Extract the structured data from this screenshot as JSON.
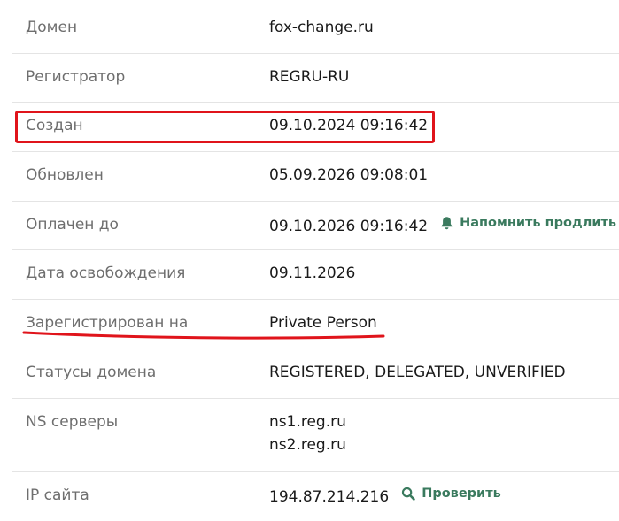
{
  "rows": [
    {
      "label": "Домен",
      "value": "fox-change.ru"
    },
    {
      "label": "Регистратор",
      "value": "REGRU-RU"
    },
    {
      "label": "Создан",
      "value": "09.10.2024 09:16:42"
    },
    {
      "label": "Обновлен",
      "value": "05.09.2026 09:08:01"
    },
    {
      "label": "Оплачен до",
      "value": "09.10.2026 09:16:42",
      "action": "Напомнить продлить"
    },
    {
      "label": "Дата освобождения",
      "value": "09.11.2026"
    },
    {
      "label": "Зарегистрирован на",
      "value": "Private Person"
    },
    {
      "label": "Статусы домена",
      "value": "REGISTERED, DELEGATED, UNVERIFIED"
    },
    {
      "label": "NS серверы",
      "values": [
        "ns1.reg.ru",
        "ns2.reg.ru"
      ]
    },
    {
      "label": "IP сайта",
      "value": "194.87.214.216",
      "action": "Проверить"
    }
  ],
  "colors": {
    "accent": "#3a7a5e",
    "highlight": "#e0141b",
    "label": "#6e6e6e",
    "text": "#1a1a1a"
  },
  "icons": {
    "reminder": "bell-icon",
    "check": "search-icon"
  }
}
